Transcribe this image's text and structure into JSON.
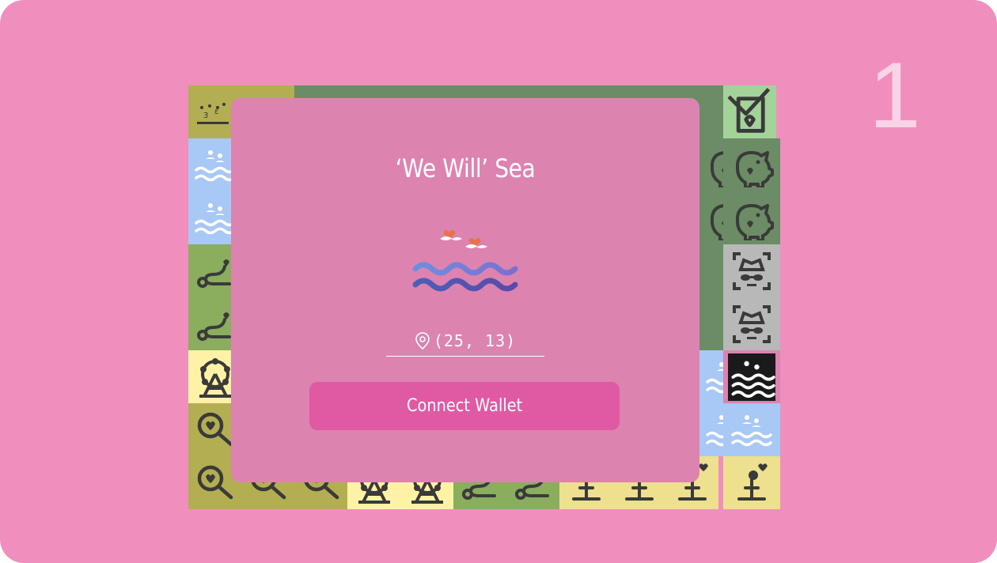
{
  "page": {
    "number": "1"
  },
  "modal": {
    "title": "‘We Will’ Sea",
    "coordinates": "(25, 13)",
    "connect_label": "Connect Wallet"
  },
  "colors": {
    "background": "#f08fbd",
    "card": "#dc83b0",
    "button": "#e05aa3",
    "text": "#ffffff",
    "icon_stroke": "#3a3a3a"
  },
  "map_tiles": [
    {
      "icon": "music-notes-icon",
      "bg": "#b3ae52"
    },
    {
      "icon": "bird-icon",
      "bg": "#6b8c64"
    },
    {
      "icon": "letter-check-icon",
      "bg": "#a4d39a"
    },
    {
      "icon": "sea-waves-icon",
      "bg": "#a8c8f5"
    },
    {
      "icon": "piggy-bank-icon",
      "bg": "#6b8c64"
    },
    {
      "icon": "spy-face-icon",
      "bg": "#b8b8b8"
    },
    {
      "icon": "winding-path-heart-icon",
      "bg": "#8bad5e"
    },
    {
      "icon": "ferris-wheel-icon",
      "bg": "#fff2a6"
    },
    {
      "icon": "magnifier-heart-icon",
      "bg": "#b3ae52"
    },
    {
      "icon": "sea-waves-dark-icon",
      "bg": "#1a1a1a"
    },
    {
      "icon": "signpost-heart-icon",
      "bg": "#ede08f"
    }
  ]
}
